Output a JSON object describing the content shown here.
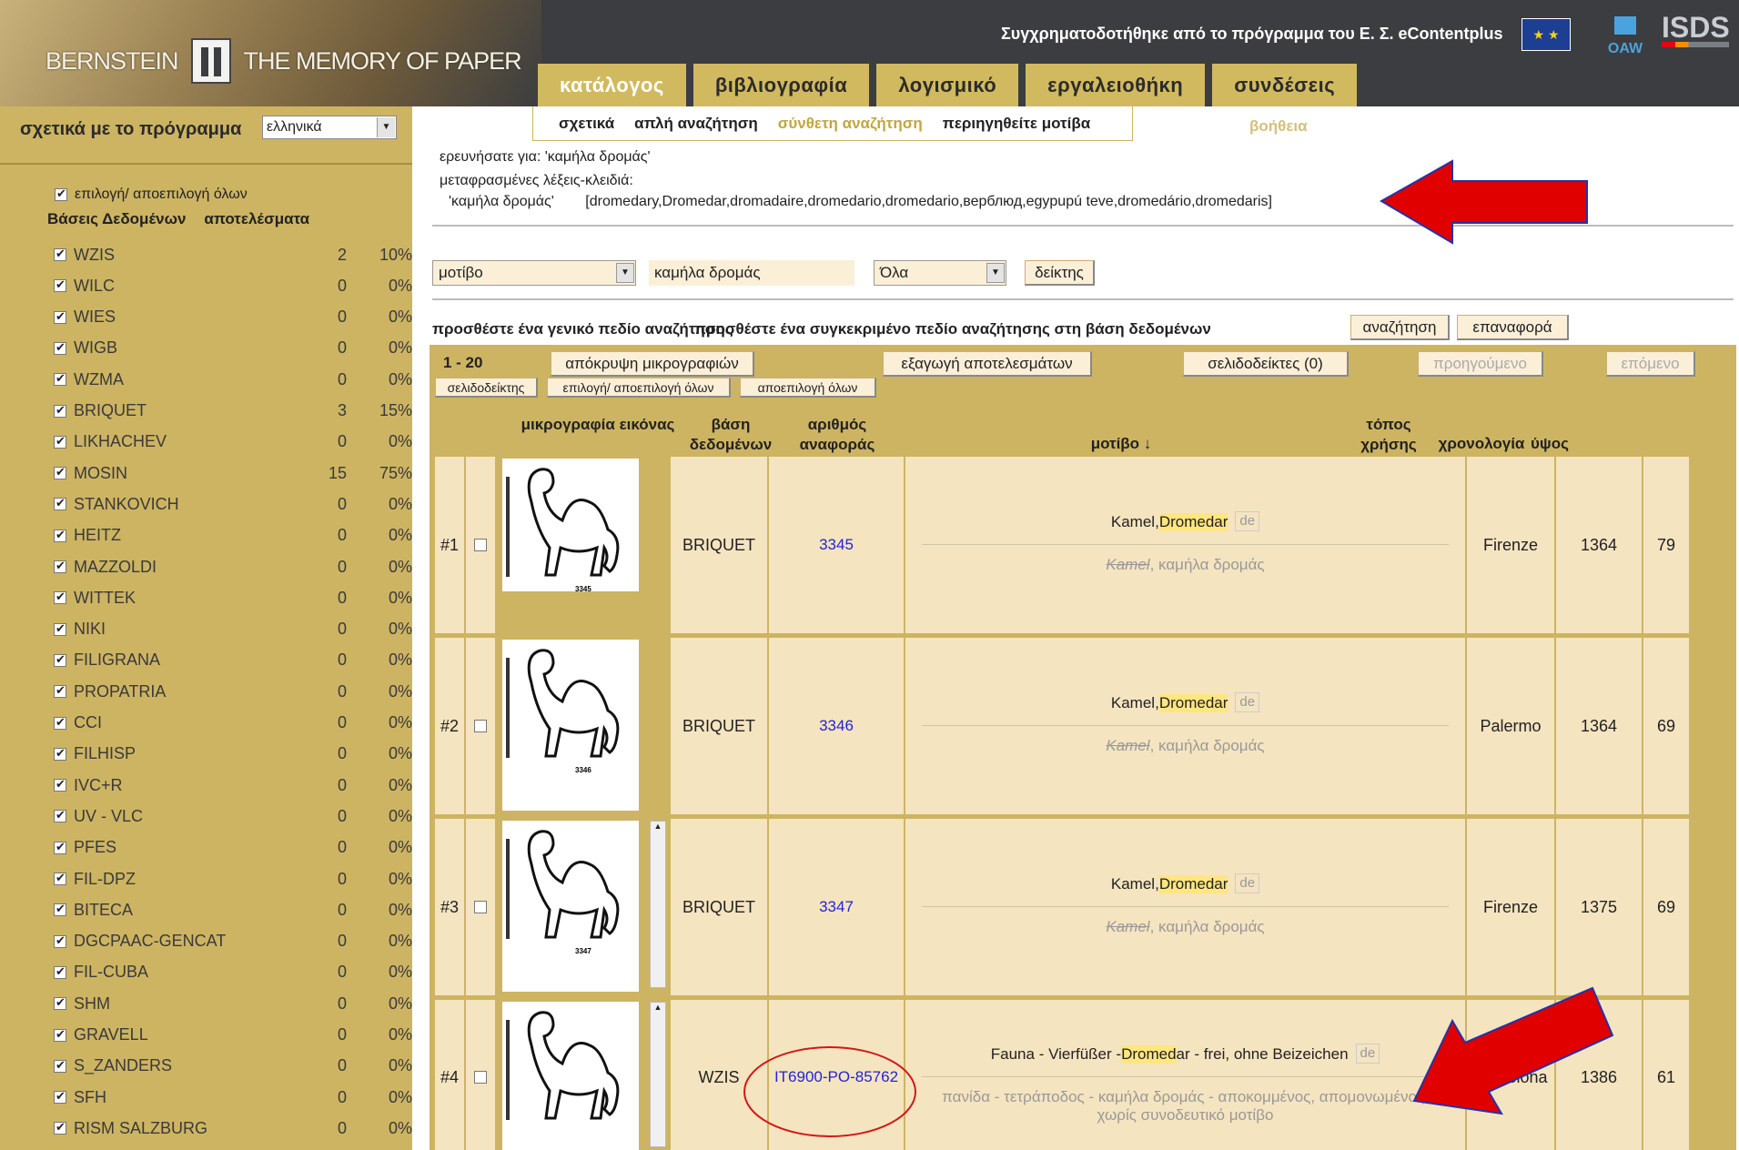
{
  "header": {
    "logo_left": "BERNSTEIN",
    "logo_right": "THE MEMORY OF PAPER",
    "funded": "Συγχρηματοδοτήθηκε από το πρόγραμμα του Ε. Σ. eContentplus",
    "oaw": "OAW",
    "isds": "ISDS",
    "tabs": [
      "κατάλογος",
      "βιβλιογραφία",
      "λογισμικό",
      "εργαλειοθήκη",
      "συνδέσεις"
    ]
  },
  "sidebar": {
    "about": "σχετικά με το πρόγραμμα",
    "language": "ελληνικά",
    "select_all": "επιλογή/ αποεπιλογή όλων",
    "col_db": "Βάσεις Δεδομένων",
    "col_results": "αποτελέσματα",
    "databases": [
      {
        "name": "WZIS",
        "count": "2",
        "pct": "10%"
      },
      {
        "name": "WILC",
        "count": "0",
        "pct": "0%"
      },
      {
        "name": "WIES",
        "count": "0",
        "pct": "0%"
      },
      {
        "name": "WIGB",
        "count": "0",
        "pct": "0%"
      },
      {
        "name": "WZMA",
        "count": "0",
        "pct": "0%"
      },
      {
        "name": "BRIQUET",
        "count": "3",
        "pct": "15%"
      },
      {
        "name": "LIKHACHEV",
        "count": "0",
        "pct": "0%"
      },
      {
        "name": "MOSIN",
        "count": "15",
        "pct": "75%"
      },
      {
        "name": "STANKOVICH",
        "count": "0",
        "pct": "0%"
      },
      {
        "name": "HEITZ",
        "count": "0",
        "pct": "0%"
      },
      {
        "name": "MAZZOLDI",
        "count": "0",
        "pct": "0%"
      },
      {
        "name": "WITTEK",
        "count": "0",
        "pct": "0%"
      },
      {
        "name": "NIKI",
        "count": "0",
        "pct": "0%"
      },
      {
        "name": "FILIGRANA",
        "count": "0",
        "pct": "0%"
      },
      {
        "name": "PROPATRIA",
        "count": "0",
        "pct": "0%"
      },
      {
        "name": "CCI",
        "count": "0",
        "pct": "0%"
      },
      {
        "name": "FILHISP",
        "count": "0",
        "pct": "0%"
      },
      {
        "name": "IVC+R",
        "count": "0",
        "pct": "0%"
      },
      {
        "name": "UV - VLC",
        "count": "0",
        "pct": "0%"
      },
      {
        "name": "PFES",
        "count": "0",
        "pct": "0%"
      },
      {
        "name": "FIL-DPZ",
        "count": "0",
        "pct": "0%"
      },
      {
        "name": "BITECA",
        "count": "0",
        "pct": "0%"
      },
      {
        "name": "DGCPAAC-GENCAT",
        "count": "0",
        "pct": "0%"
      },
      {
        "name": "FIL-CUBA",
        "count": "0",
        "pct": "0%"
      },
      {
        "name": "SHM",
        "count": "0",
        "pct": "0%"
      },
      {
        "name": "GRAVELL",
        "count": "0",
        "pct": "0%"
      },
      {
        "name": "S_ZANDERS",
        "count": "0",
        "pct": "0%"
      },
      {
        "name": "SFH",
        "count": "0",
        "pct": "0%"
      },
      {
        "name": "RISM SALZBURG",
        "count": "0",
        "pct": "0%"
      }
    ]
  },
  "subnav": {
    "items": [
      "σχετικά",
      "απλή αναζήτηση",
      "σύνθετη αναζήτηση",
      "περιηγηθείτε μοτίβα"
    ],
    "help": "βοήθεια"
  },
  "search": {
    "searched_label": "ερευνήσατε για:",
    "searched_value": "'καμήλα δρομάς'",
    "translated_label": "μεταφρασμένες λέξεις-κλειδιά:",
    "translated_term": "'καμήλα δρομάς'",
    "translated_list": "[dromedary,Dromedar,dromadaire,dromedario,dromedario,верблюд,egypupú teve,dromedário,dromedaris]",
    "field": "μοτίβο",
    "query": "καμήλα δρομάς",
    "scope": "Όλα",
    "index_btn": "δείκτης",
    "add_general": "προσθέστε ένα γενικό πεδίο αναζήτησης",
    "add_specific": "προσθέστε ένα συγκεκριμένο πεδίο αναζήτησης στη βάση δεδομένων",
    "search_btn": "αναζήτηση",
    "reset_btn": "επαναφορά"
  },
  "results": {
    "range": "1 - 20",
    "hide_thumbs": "απόκρυψη μικρογραφιών",
    "export": "εξαγωγή αποτελεσμάτων",
    "bookmarks": "σελιδοδείκτες (0)",
    "prev": "προηγούμενο",
    "next": "επόμενο",
    "bookmark": "σελιδοδείκτης",
    "select_all": "επιλογή/ αποεπιλογή όλων",
    "deselect_all": "αποεπιλογή όλων",
    "columns": {
      "thumb": "μικρογραφία εικόνας",
      "db": "βάση δεδομένων",
      "ref": "αριθμός αναφοράς",
      "motif": "μοτίβο ↓",
      "place": "τόπος χρήσης",
      "date": "χρονολογία",
      "height": "ύψος"
    },
    "rows": [
      {
        "num": "#1",
        "db": "BRIQUET",
        "ref": "3345",
        "m1a": "Kamel, ",
        "m1b": "Dromedar",
        "m1c": "",
        "lang": "de",
        "m2a": "Kamel",
        "m2b": ", καμήλα δρομάς",
        "place": "Firenze",
        "date": "1364",
        "height": "79",
        "img": "3345"
      },
      {
        "num": "#2",
        "db": "BRIQUET",
        "ref": "3346",
        "m1a": "Kamel, ",
        "m1b": "Dromedar",
        "m1c": "",
        "lang": "de",
        "m2a": "Kamel",
        "m2b": ", καμήλα δρομάς",
        "place": "Palermo",
        "date": "1364",
        "height": "69",
        "img": "3346"
      },
      {
        "num": "#3",
        "db": "BRIQUET",
        "ref": "3347",
        "m1a": "Kamel, ",
        "m1b": "Dromedar",
        "m1c": "",
        "lang": "de",
        "m2a": "Kamel",
        "m2b": ", καμήλα δρομάς",
        "place": "Firenze",
        "date": "1375",
        "height": "69",
        "img": "3347"
      },
      {
        "num": "#4",
        "db": "WZIS",
        "ref": "IT6900-PO-85762",
        "m1a": "Fauna - Vierfüßer - ",
        "m1b": "Dromed",
        "m1c": "ar - frei, ohne Beizeichen",
        "lang": "de",
        "m2a": "",
        "m2b": "πανίδα - τετράποδος - καμήλα δρομάς - αποκομμένος, απομονωμένος, χωρίς συνοδευτικό μοτίβο",
        "place": "Barcelona",
        "date": "1386",
        "height": "61",
        "img": ""
      }
    ]
  }
}
